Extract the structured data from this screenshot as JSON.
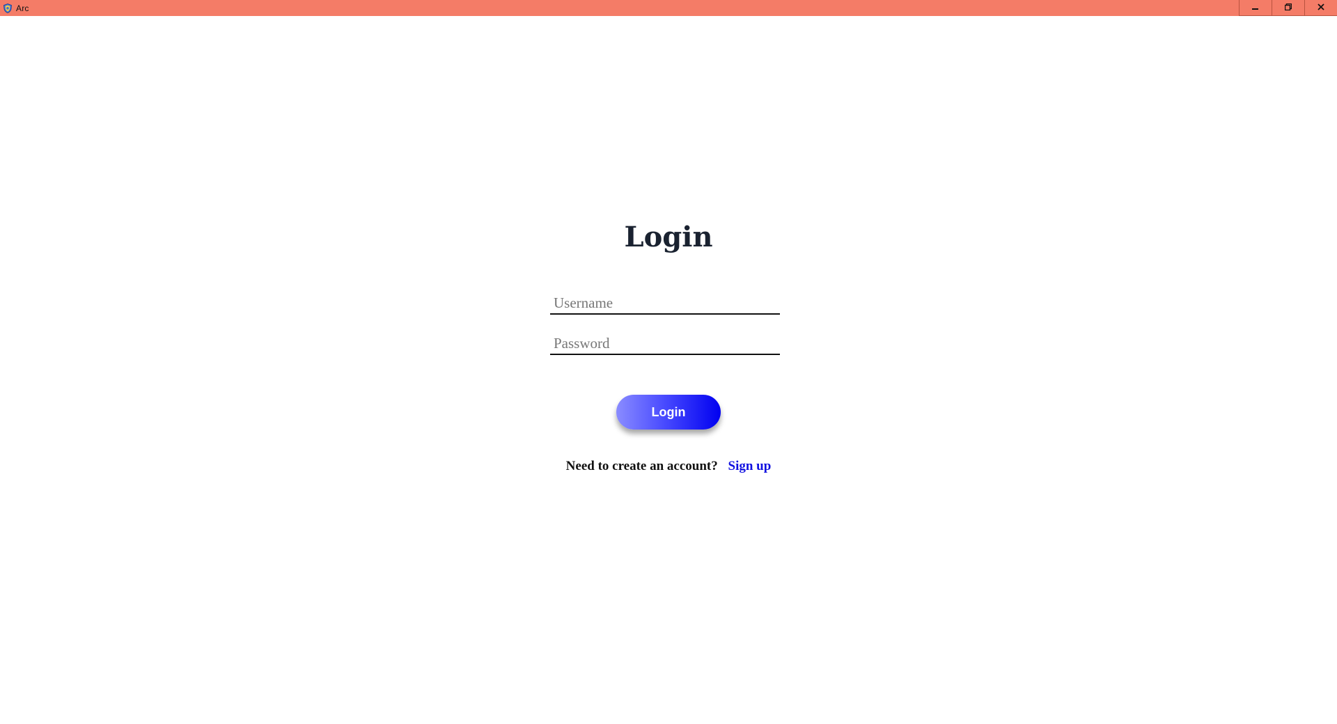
{
  "window": {
    "title": "Arc",
    "app_icon": "shield-icon",
    "controls": {
      "minimize_icon": "minimize-icon",
      "restore_icon": "restore-icon",
      "close_icon": "close-icon"
    },
    "titlebar_color": "#f47c67"
  },
  "login": {
    "heading": "Login",
    "username_placeholder": "Username",
    "password_placeholder": "Password",
    "button_label": "Login",
    "signup_prompt": "Need to create an account?",
    "signup_link": "Sign up"
  },
  "colors": {
    "button_gradient_start": "#8a8cff",
    "button_gradient_end": "#0000f0",
    "link": "#1010e0",
    "heading": "#1a2230"
  }
}
